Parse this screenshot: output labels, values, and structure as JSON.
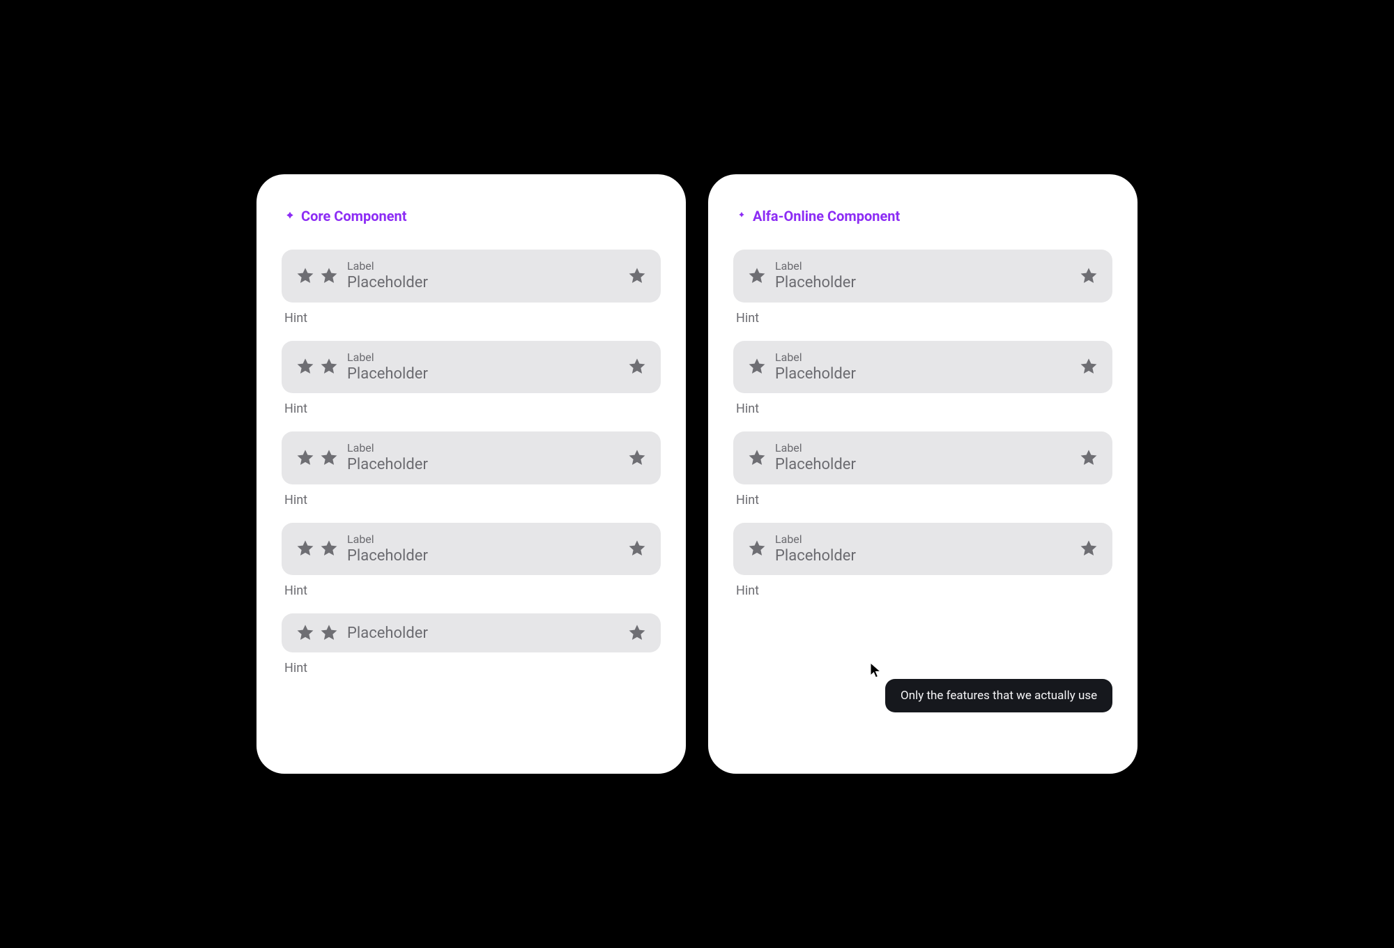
{
  "panels": {
    "core": {
      "title": "Core Component",
      "fields": [
        {
          "label": "Label",
          "placeholder": "Placeholder",
          "hint": "Hint",
          "leftStars": 2,
          "showLabel": true
        },
        {
          "label": "Label",
          "placeholder": "Placeholder",
          "hint": "Hint",
          "leftStars": 2,
          "showLabel": true
        },
        {
          "label": "Label",
          "placeholder": "Placeholder",
          "hint": "Hint",
          "leftStars": 2,
          "showLabel": true
        },
        {
          "label": "Label",
          "placeholder": "Placeholder",
          "hint": "Hint",
          "leftStars": 2,
          "showLabel": true
        },
        {
          "label": "",
          "placeholder": "Placeholder",
          "hint": "Hint",
          "leftStars": 2,
          "showLabel": false
        }
      ]
    },
    "alfa": {
      "title": "Alfa-Online Component",
      "fields": [
        {
          "label": "Label",
          "placeholder": "Placeholder",
          "hint": "Hint",
          "leftStars": 1,
          "showLabel": true
        },
        {
          "label": "Label",
          "placeholder": "Placeholder",
          "hint": "Hint",
          "leftStars": 1,
          "showLabel": true
        },
        {
          "label": "Label",
          "placeholder": "Placeholder",
          "hint": "Hint",
          "leftStars": 1,
          "showLabel": true
        },
        {
          "label": "Label",
          "placeholder": "Placeholder",
          "hint": "Hint",
          "leftStars": 1,
          "showLabel": true
        }
      ]
    }
  },
  "tooltip": {
    "text": "Only the features that we actually use"
  },
  "colors": {
    "accent": "#8C2CF4",
    "field_bg": "#E6E6E8",
    "muted_text": "#6B6B70",
    "tooltip_bg": "#16181D"
  }
}
